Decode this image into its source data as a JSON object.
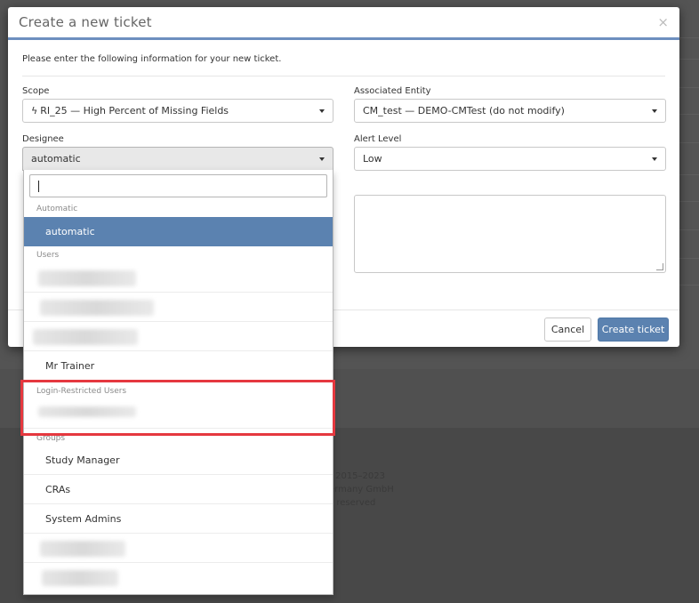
{
  "modal": {
    "title": "Create a new ticket",
    "close_symbol": "×",
    "intro": "Please enter the following information for your new ticket."
  },
  "fields": {
    "scope": {
      "label": "Scope",
      "value": "RI_25 — High Percent of Missing Fields",
      "icon": "lightning-bolt-icon"
    },
    "associated_entity": {
      "label": "Associated Entity",
      "value": "CM_test — DEMO-CMTest (do not modify)"
    },
    "designee": {
      "label": "Designee",
      "value": "automatic"
    },
    "alert_level": {
      "label": "Alert Level",
      "value": "Low"
    }
  },
  "buttons": {
    "cancel": "Cancel",
    "create": "Create ticket"
  },
  "dropdown": {
    "search_value": "",
    "groups": {
      "automatic": "Automatic",
      "users": "Users",
      "login_restricted": "Login-Restricted Users",
      "groups": "Groups"
    },
    "options": {
      "automatic": "automatic",
      "mr_trainer": "Mr Trainer",
      "study_manager": "Study Manager",
      "cras": "CRAs",
      "system_admins": "System Admins"
    }
  },
  "footer": {
    "line1": "t 2015–2023",
    "line2": "ermany GmbH",
    "line3": "s reserved"
  },
  "colors": {
    "accent": "#5b82b0",
    "header_border": "#6d8fbf",
    "highlight": "#e5383f"
  }
}
